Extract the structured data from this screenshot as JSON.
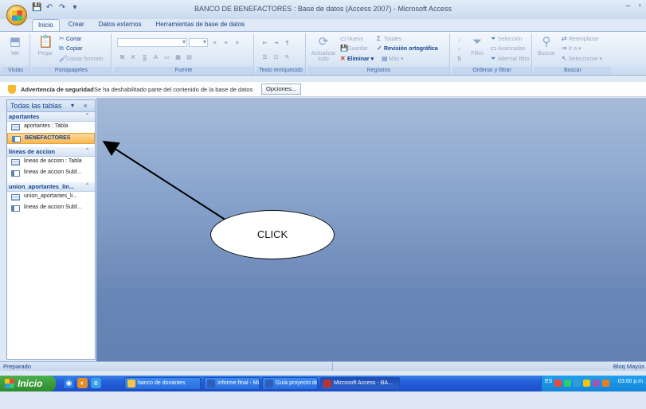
{
  "window": {
    "title": "BANCO DE BENEFACTORES : Base de datos (Access 2007) - Microsoft Access",
    "controls": [
      "–",
      "▫"
    ]
  },
  "qat": [
    "💾",
    "↶",
    "↷",
    "▾"
  ],
  "tabs": [
    "Inicio",
    "Crear",
    "Datos externos",
    "Herramientas de base de datos"
  ],
  "ribbon": {
    "groups": {
      "vistas": "Vistas",
      "portapapeles": "Portapapeles",
      "fuente": "Fuente",
      "texto": "Texto enriquecido",
      "registros": "Registros",
      "ordenar": "Ordenar y filtrar",
      "buscar": "Buscar"
    },
    "ver": "Ver",
    "pegar": "Pegar",
    "cortar": "Cortar",
    "copiar": "Copiar",
    "copiar_formato": "Copiar formato",
    "actualizar": "Actualizar",
    "actualizar2": "todo",
    "nuevo": "Nuevo",
    "totales": "Totales",
    "guardar": "Guardar",
    "revision": "Revisión ortográfica",
    "eliminar": "Eliminar",
    "mas": "Más",
    "filtro": "Filtro",
    "seleccion": "Selección",
    "avanzadas": "Avanzadas",
    "alternar": "Alternar filtro",
    "buscar_btn": "Buscar",
    "reemplazar": "Reemplazar",
    "ir_a": "Ir a",
    "seleccionar": "Seleccionar"
  },
  "security": {
    "title": "Advertencia de seguridad",
    "message": "Se ha deshabilitado parte del contenido de la base de datos",
    "options": "Opciones..."
  },
  "nav": {
    "header": "Todas las tablas",
    "groups": [
      {
        "label": "aportantes",
        "items": [
          {
            "label": "aportantes : Tabla",
            "type": "table"
          },
          {
            "label": "BENEFACTORES",
            "type": "form",
            "selected": true
          }
        ]
      },
      {
        "label": "lineas de accion",
        "items": [
          {
            "label": "lineas de accion : Tabla",
            "type": "table"
          },
          {
            "label": "lineas de accion Subf...",
            "type": "form"
          }
        ]
      },
      {
        "label": "union_aportantes_lin...",
        "items": [
          {
            "label": "union_aportantes_li...",
            "type": "table"
          },
          {
            "label": "lineas de accion Subf...",
            "type": "form"
          }
        ]
      }
    ]
  },
  "annotation": {
    "label": "CLICK"
  },
  "status": {
    "left": "Preparado",
    "right": "Bloq Mayús"
  },
  "taskbar": {
    "start": "Inicio",
    "tasks": [
      {
        "label": "banco de donantes",
        "color": "#f5c542"
      },
      {
        "label": "Informe final - Micros...",
        "color": "#2b5fb8"
      },
      {
        "label": "Guía proyecto de gra...",
        "color": "#2b5fb8"
      },
      {
        "label": "Microsoft Access - BA...",
        "color": "#b8332b",
        "active": true
      }
    ],
    "lang": "ES",
    "clock": "03:00 p.m."
  }
}
